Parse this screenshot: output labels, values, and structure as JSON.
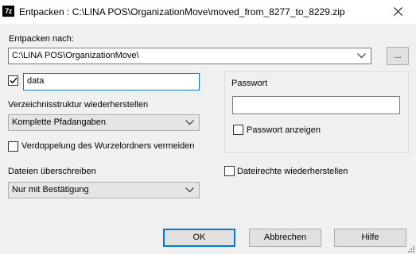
{
  "window": {
    "app_icon_text": "7z",
    "title": "Entpacken : C:\\LINA POS\\OrganizationMove\\moved_from_8277_to_8229.zip"
  },
  "extract_to": {
    "label": "Entpacken nach:",
    "path": "C:\\LINA POS\\OrganizationMove\\",
    "browse_label": "..."
  },
  "subfolder": {
    "checked": true,
    "value": "data"
  },
  "path_mode": {
    "label": "Verzeichnisstruktur wiederherstellen",
    "selected": "Komplette Pfadangaben"
  },
  "eliminate_duplicates": {
    "label": "Verdoppelung des Wurzelordners vermeiden",
    "checked": false
  },
  "overwrite": {
    "label": "Dateien überschreiben",
    "selected": "Nur mit Bestätigung"
  },
  "password": {
    "group_label": "Passwort",
    "value": "",
    "show_label": "Passwort anzeigen",
    "show_checked": false
  },
  "restore_rights": {
    "label": "Dateirechte wiederherstellen",
    "checked": false
  },
  "buttons": {
    "ok": "OK",
    "cancel": "Abbrechen",
    "help": "Hilfe"
  }
}
